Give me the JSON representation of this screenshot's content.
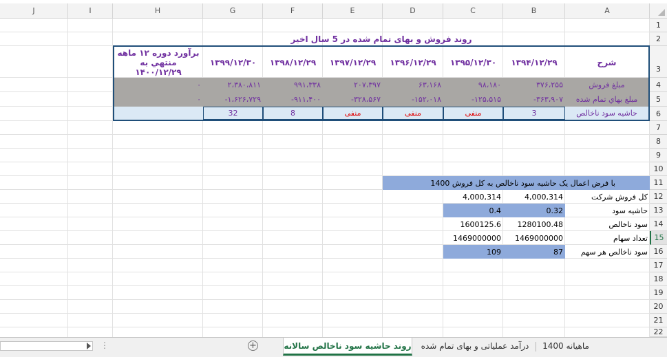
{
  "columns": [
    "J",
    "I",
    "H",
    "G",
    "F",
    "E",
    "D",
    "C",
    "B",
    "A"
  ],
  "rows": [
    "1",
    "2",
    "3",
    "4",
    "5",
    "6",
    "7",
    "8",
    "9",
    "10",
    "11",
    "12",
    "13",
    "14",
    "15",
    "16",
    "17",
    "18",
    "19",
    "20",
    "21",
    "22"
  ],
  "title": "روند فروش و بهای تمام شده در 5 سال اخیر",
  "header": {
    "a": "شرح",
    "b": "۱۳۹۴/۱۲/۲۹",
    "c": "۱۳۹۵/۱۲/۳۰",
    "d": "۱۳۹۶/۱۲/۲۹",
    "e": "۱۳۹۷/۱۲/۲۹",
    "f": "۱۳۹۸/۱۲/۲۹",
    "g": "۱۳۹۹/۱۲/۳۰",
    "h": "برآورد دوره ۱۲ ماهه منتهي به ۱۴۰۰/۱۲/۲۹"
  },
  "row4": {
    "a": "مبلغ فروش",
    "b": "۳۷۶،۲۵۵",
    "c": "۹۸،۱۸۰",
    "d": "۶۳،۱۶۸",
    "e": "۲۰۷،۳۹۷",
    "f": "۹۹۱،۳۳۸",
    "g": "۲،۳۸۰،۸۱۱",
    "h": "۰"
  },
  "row5": {
    "a": "مبلغ بهاي تمام شده",
    "b": "-۳۶۳،۹۰۷",
    "c": "-۱۲۵،۵۱۵",
    "d": "-۱۵۲،۰۱۸",
    "e": "-۳۲۸،۵۶۷",
    "f": "-۹۱۱،۴۰۰",
    "g": "-۱،۶۲۶،۷۲۹",
    "h": "۰"
  },
  "row6": {
    "a": "حاشیه سود ناخالص",
    "b": "3",
    "c": "منفی",
    "d": "منفی",
    "e": "منفی",
    "f": "8",
    "g": "32"
  },
  "row11": {
    "text": "با فرض اعمال یک حاشیه سود ناخالص به کل فروش 1400"
  },
  "row12": {
    "a": "کل فروش شرکت",
    "b": "4,000,314",
    "c": "4,000,314"
  },
  "row13": {
    "a": "حاشیه سود",
    "b": "0.32",
    "c": "0.4"
  },
  "row14": {
    "a": "سود ناخالص",
    "b": "1280100.48",
    "c": "1600125.6"
  },
  "row15": {
    "a": "تعداد سهام",
    "b": "1469000000",
    "c": "1469000000"
  },
  "row16": {
    "a": "سود ناخالص هر سهم",
    "b": "87",
    "c": "109"
  },
  "tabs": {
    "tab1": "ماهیانه 1400",
    "tab2": "درآمد عملیاتی و بهای تمام شده",
    "tab3": "روند حاشیه سود ناخالص سالانه",
    "add": "+",
    "dots": "⋮"
  },
  "colors": {
    "purple": "#7030a0",
    "red": "#e00000",
    "grey_fill": "#a9a7a4",
    "light_blue": "#dbe9f5",
    "mid_blue": "#8eaadb",
    "excel_green": "#217346"
  }
}
